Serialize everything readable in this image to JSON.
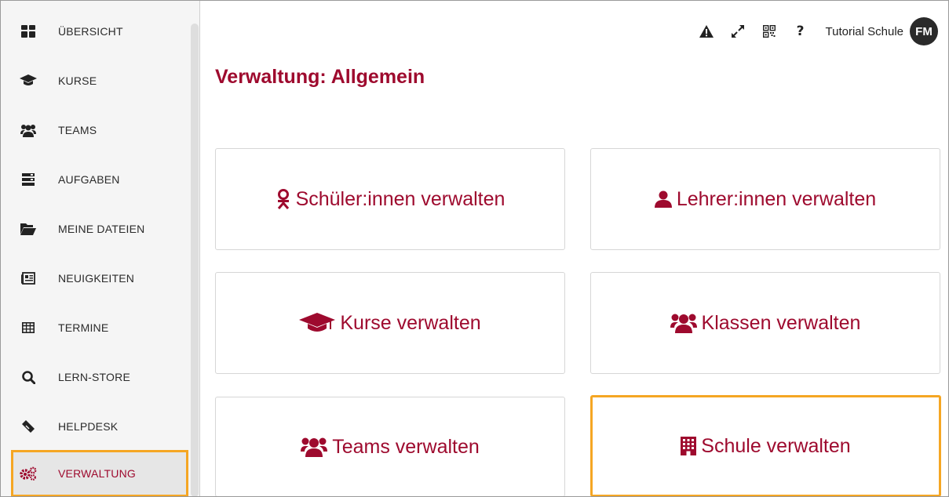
{
  "sidebar": {
    "items": [
      {
        "label": "ÜBERSICHT",
        "icon": "dashboard-icon"
      },
      {
        "label": "KURSE",
        "icon": "graduation-cap-icon"
      },
      {
        "label": "TEAMS",
        "icon": "users-icon"
      },
      {
        "label": "AUFGABEN",
        "icon": "tasks-icon"
      },
      {
        "label": "MEINE DATEIEN",
        "icon": "folder-open-icon"
      },
      {
        "label": "NEUIGKEITEN",
        "icon": "newspaper-icon"
      },
      {
        "label": "TERMINE",
        "icon": "calendar-table-icon"
      },
      {
        "label": "LERN-STORE",
        "icon": "search-icon"
      },
      {
        "label": "HELPDESK",
        "icon": "ticket-icon"
      },
      {
        "label": "VERWALTUNG",
        "icon": "cogs-icon",
        "active": true
      }
    ]
  },
  "topbar": {
    "icons": [
      "warning-icon",
      "expand-icon",
      "qrcode-icon",
      "help-icon"
    ],
    "help_glyph": "?",
    "school_name": "Tutorial Schule",
    "avatar_initials": "FM"
  },
  "page": {
    "title": "Verwaltung: Allgemein"
  },
  "cards": [
    {
      "label": "Schüler:innen verwalten",
      "icon": "student-icon"
    },
    {
      "label": "Lehrer:innen verwalten",
      "icon": "user-icon"
    },
    {
      "label": "Kurse verwalten",
      "icon": "graduation-cap-icon"
    },
    {
      "label": "Klassen verwalten",
      "icon": "users-icon"
    },
    {
      "label": "Teams verwalten",
      "icon": "users-icon"
    },
    {
      "label": "Schule verwalten",
      "icon": "building-icon",
      "highlighted": true
    }
  ],
  "colors": {
    "accent": "#9e0a2e",
    "highlight": "#f5a623",
    "sidebar_bg": "#f5f5f5"
  }
}
